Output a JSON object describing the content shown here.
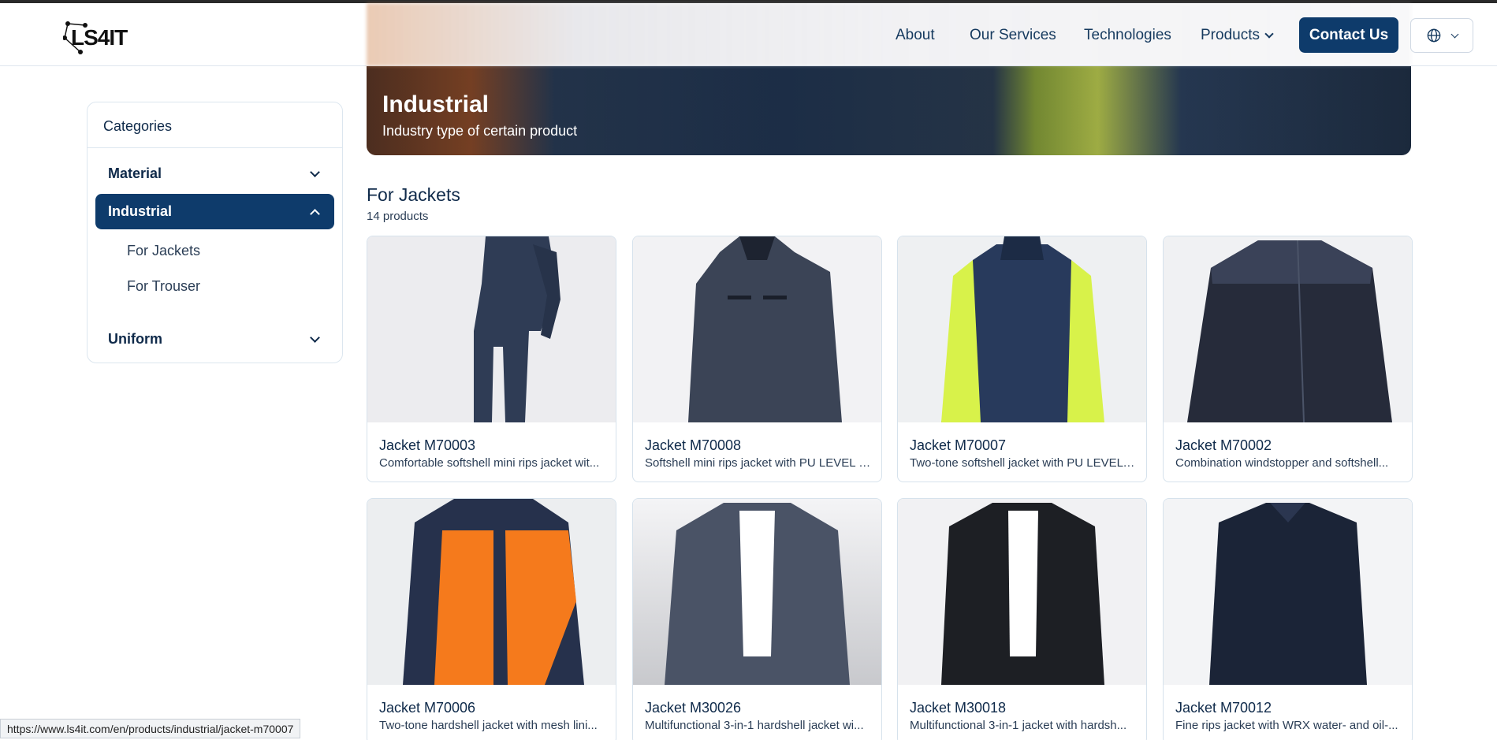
{
  "header": {
    "logo_text": "LS4IT",
    "nav": {
      "about": "About",
      "services": "Our Services",
      "technologies": "Technologies",
      "products": "Products"
    },
    "contact_label": "Contact Us",
    "language_icon": "globe-icon"
  },
  "banner": {
    "title": "Industrial",
    "subtitle": "Industry type of certain product"
  },
  "sidebar": {
    "heading": "Categories",
    "items": [
      {
        "label": "Material",
        "expanded": false
      },
      {
        "label": "Industrial",
        "expanded": true,
        "subitems": [
          "For Jackets",
          "For Trouser"
        ]
      },
      {
        "label": "Uniform",
        "expanded": false
      }
    ]
  },
  "section": {
    "title": "For Jackets",
    "count": "14 products"
  },
  "products": [
    {
      "name": "Jacket M70003",
      "desc": "Comfortable softshell mini rips jacket wit..."
    },
    {
      "name": "Jacket M70008",
      "desc": "Softshell mini rips jacket with PU LEVEL X..."
    },
    {
      "name": "Jacket M70007",
      "desc": "Two-tone softshell jacket with PU LEVEL ..."
    },
    {
      "name": "Jacket M70002",
      "desc": "Combination windstopper and softshell..."
    },
    {
      "name": "Jacket M70006",
      "desc": "Two-tone hardshell jacket with mesh lini..."
    },
    {
      "name": "Jacket M30026",
      "desc": "Multifunctional 3-in-1 hardshell jacket wi..."
    },
    {
      "name": "Jacket M30018",
      "desc": "Multifunctional 3-in-1 jacket with hardsh..."
    },
    {
      "name": "Jacket M70012",
      "desc": "Fine rips jacket with WRX water- and oil-..."
    }
  ],
  "status_url": "https://www.ls4it.com/en/products/industrial/jacket-m70007",
  "colors": {
    "primary": "#0e3b6b",
    "text": "#0f2a4a",
    "border": "#d6e2ec"
  }
}
